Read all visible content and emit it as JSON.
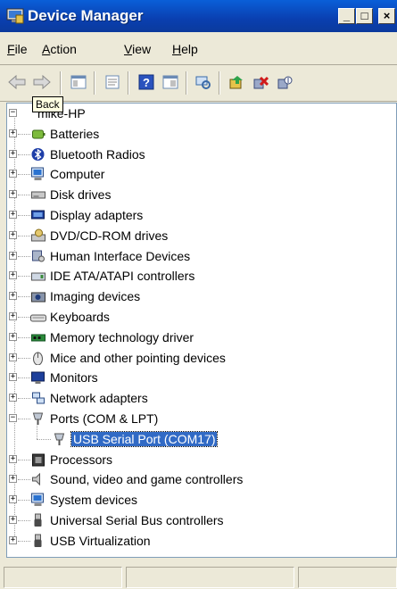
{
  "window": {
    "title": "Device Manager"
  },
  "menu": [
    {
      "label": "File",
      "underline": "F",
      "rest": "ile"
    },
    {
      "label": "Action",
      "underline": "A",
      "rest": "ction"
    },
    {
      "label": "View",
      "underline": "V",
      "rest": "iew"
    },
    {
      "label": "Help",
      "underline": "H",
      "rest": "elp"
    }
  ],
  "toolbar": {
    "tooltip": "Back",
    "buttons": [
      "back-arrow-icon",
      "forward-arrow-icon",
      "show-hide-tree-icon",
      "properties-icon",
      "help-icon",
      "console-tree-icon",
      "scan-hardware-icon",
      "update-driver-icon",
      "uninstall-icon",
      "disable-icon"
    ]
  },
  "tree": {
    "root": "mike-HP",
    "categories": [
      {
        "label": "Batteries",
        "icon": "battery-icon",
        "expanded": false
      },
      {
        "label": "Bluetooth Radios",
        "icon": "bluetooth-icon",
        "expanded": false
      },
      {
        "label": "Computer",
        "icon": "computer-icon",
        "expanded": false
      },
      {
        "label": "Disk drives",
        "icon": "disk-drive-icon",
        "expanded": false
      },
      {
        "label": "Display adapters",
        "icon": "display-adapter-icon",
        "expanded": false
      },
      {
        "label": "DVD/CD-ROM drives",
        "icon": "dvd-drive-icon",
        "expanded": false
      },
      {
        "label": "Human Interface Devices",
        "icon": "hid-icon",
        "expanded": false
      },
      {
        "label": "IDE ATA/ATAPI controllers",
        "icon": "ide-controller-icon",
        "expanded": false
      },
      {
        "label": "Imaging devices",
        "icon": "camera-icon",
        "expanded": false
      },
      {
        "label": "Keyboards",
        "icon": "keyboard-icon",
        "expanded": false
      },
      {
        "label": "Memory technology driver",
        "icon": "memory-icon",
        "expanded": false
      },
      {
        "label": "Mice and other pointing devices",
        "icon": "mouse-icon",
        "expanded": false
      },
      {
        "label": "Monitors",
        "icon": "monitor-icon",
        "expanded": false
      },
      {
        "label": "Network adapters",
        "icon": "network-icon",
        "expanded": false
      },
      {
        "label": "Ports (COM & LPT)",
        "icon": "port-icon",
        "expanded": true,
        "children": [
          {
            "label": "USB Serial Port (COM17)",
            "icon": "port-icon",
            "selected": true
          }
        ]
      },
      {
        "label": "Processors",
        "icon": "processor-icon",
        "expanded": false
      },
      {
        "label": "Sound, video and game controllers",
        "icon": "sound-icon",
        "expanded": false
      },
      {
        "label": "System devices",
        "icon": "system-icon",
        "expanded": false
      },
      {
        "label": "Universal Serial Bus controllers",
        "icon": "usb-icon",
        "expanded": false
      },
      {
        "label": "USB Virtualization",
        "icon": "usb-icon",
        "expanded": false
      }
    ]
  },
  "colors": {
    "titlebar": "#0a4fc8",
    "selection": "#316ac5",
    "chrome": "#ece9d8"
  }
}
